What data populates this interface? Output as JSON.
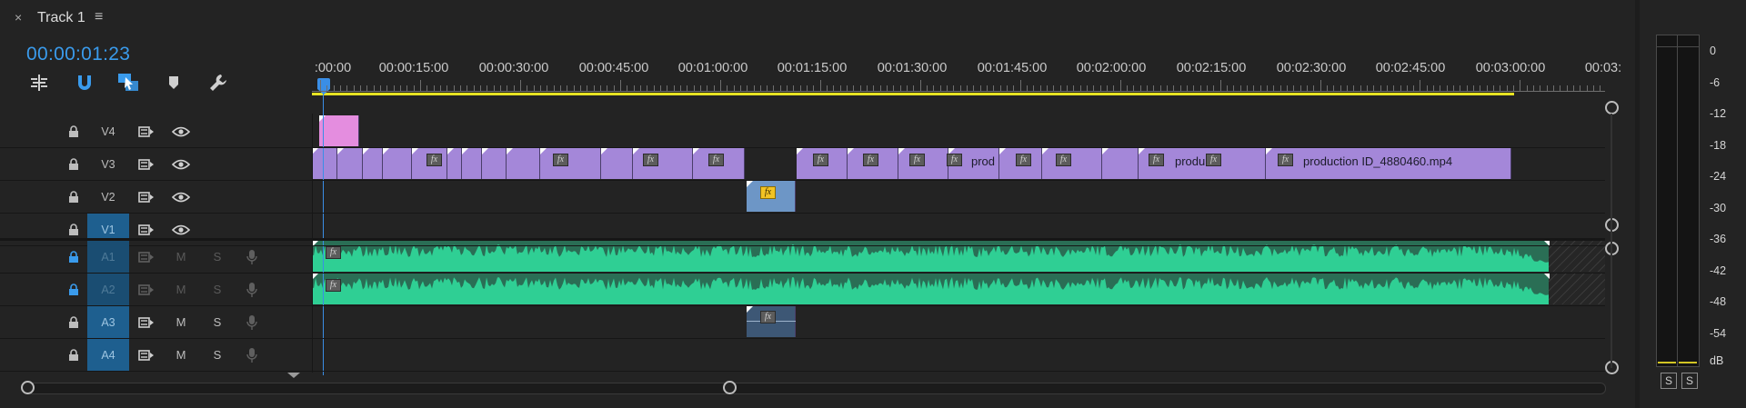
{
  "panel": {
    "close_glyph": "×",
    "title": "Track 1",
    "menu_glyph": "≡",
    "timecode": "00:00:01:23"
  },
  "toolbar": {
    "tools": [
      {
        "name": "insert-nest-icon"
      },
      {
        "name": "snap-magnet-icon"
      },
      {
        "name": "linked-selection-icon"
      },
      {
        "name": "add-marker-icon"
      },
      {
        "name": "timeline-settings-wrench-icon"
      }
    ]
  },
  "ruler": {
    "labels": [
      ":00:00",
      "00:00:15:00",
      "00:00:30:00",
      "00:00:45:00",
      "00:01:00:00",
      "00:01:15:00",
      "00:01:30:00",
      "00:01:45:00",
      "00:02:00:00",
      "00:02:15:00",
      "00:02:30:00",
      "00:02:45:00",
      "00:03:00:00",
      "00:03:"
    ]
  },
  "tracks": {
    "video": [
      {
        "id": "v4",
        "label": "V4",
        "targeted": false
      },
      {
        "id": "v3",
        "label": "V3",
        "targeted": false
      },
      {
        "id": "v2",
        "label": "V2",
        "targeted": false
      },
      {
        "id": "v1",
        "label": "V1",
        "targeted": true
      }
    ],
    "audio": [
      {
        "id": "a1",
        "label": "A1",
        "mute": "M",
        "solo": "S",
        "dimmed": true
      },
      {
        "id": "a2",
        "label": "A2",
        "mute": "M",
        "solo": "S",
        "dimmed": true
      },
      {
        "id": "a3",
        "label": "A3",
        "mute": "M",
        "solo": "S",
        "dimmed": false
      },
      {
        "id": "a4",
        "label": "A4",
        "mute": "M",
        "solo": "S",
        "dimmed": false
      }
    ]
  },
  "clips": {
    "v3_names": [
      "prod",
      "produ",
      "production ID_4880460.mp4"
    ]
  },
  "meter": {
    "db_labels": [
      "0",
      "-6",
      "-12",
      "-18",
      "-24",
      "-30",
      "-36",
      "-42",
      "-48",
      "-54",
      "dB"
    ],
    "solo_left": "S",
    "solo_right": "S"
  },
  "colors": {
    "timecode": "#3a9bec",
    "video_clip": "#a487d9",
    "audio_waveform": "#2fcf94",
    "work_area_bar": "#e7e323",
    "playhead": "#3a8ee6"
  }
}
